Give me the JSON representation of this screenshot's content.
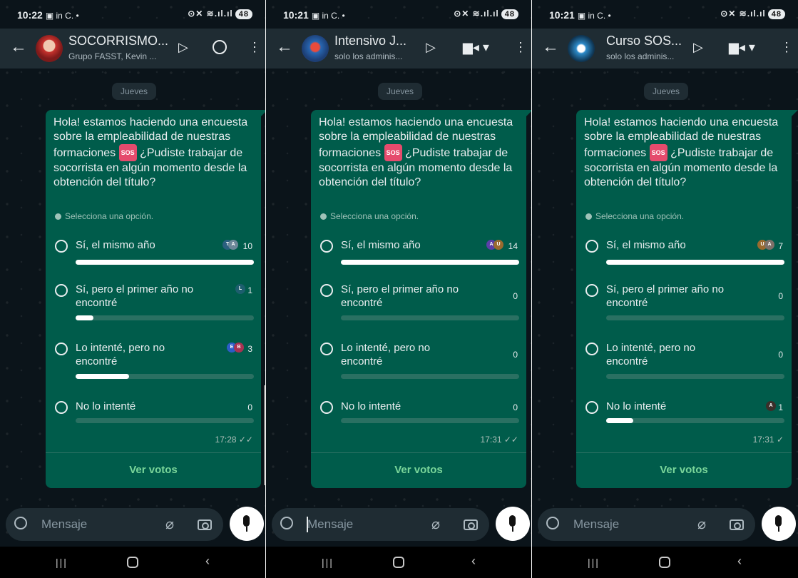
{
  "colors": {
    "bubble": "#005c4b",
    "accent": "#7ad69a",
    "background": "#0b141a",
    "appbar": "#1f2c33"
  },
  "phones": [
    {
      "status_time": "10:22",
      "status_icons": "▣ in C. •",
      "status_right": "⊙✕ ≋.ıl.ıl",
      "battery": "48",
      "chat_title": "SOCORRISMO...",
      "chat_subtitle": "Grupo FASST, Kevin ...",
      "date_chip": "Jueves",
      "question": "Hola! estamos haciendo una encuesta sobre la empleabilidad de nuestras formaciones",
      "sos_emoji": "SOS",
      "question_tail": "¿Pudiste trabajar de socorrista en algún momento desde la obtención del título?",
      "hint": "Selecciona una opción.",
      "options": [
        {
          "label": "Sí, el mismo año",
          "count": "10",
          "share": 1.0,
          "voters": [
            "T",
            "A"
          ]
        },
        {
          "label": "Sí, pero el primer año no encontré",
          "count": "1",
          "share": 0.1,
          "voters": [
            "L"
          ]
        },
        {
          "label": "Lo intenté, pero no encontré",
          "count": "3",
          "share": 0.3,
          "voters": [
            "E",
            "B"
          ]
        },
        {
          "label": "No lo intenté",
          "count": "0",
          "share": 0.0,
          "voters": []
        }
      ],
      "time": "17:28 ✓✓",
      "view_votes": "Ver votos",
      "input_placeholder": "Mensaje"
    },
    {
      "status_time": "10:21",
      "status_icons": "▣ in C. •",
      "status_right": "⊙✕ ≋.ıl.ıl",
      "battery": "48",
      "chat_title": "Intensivo J...",
      "chat_subtitle": "solo los adminis...",
      "date_chip": "Jueves",
      "question": "Hola! estamos haciendo una encuesta sobre la empleabilidad de nuestras formaciones",
      "sos_emoji": "SOS",
      "question_tail": "¿Pudiste trabajar de socorrista en algún momento desde la obtención del título?",
      "hint": "Selecciona una opción.",
      "options": [
        {
          "label": "Sí, el mismo año",
          "count": "14",
          "share": 1.0,
          "voters": [
            "A",
            "U"
          ]
        },
        {
          "label": "Sí, pero el primer año no encontré",
          "count": "0",
          "share": 0.0,
          "voters": []
        },
        {
          "label": "Lo intenté, pero no encontré",
          "count": "0",
          "share": 0.0,
          "voters": []
        },
        {
          "label": "No lo intenté",
          "count": "0",
          "share": 0.0,
          "voters": []
        }
      ],
      "time": "17:31 ✓✓",
      "view_votes": "Ver votos",
      "input_placeholder": "Mensaje"
    },
    {
      "status_time": "10:21",
      "status_icons": "▣ in C. •",
      "status_right": "⊙✕ ≋.ıl.ıl",
      "battery": "48",
      "chat_title": "Curso SOS...",
      "chat_subtitle": "solo los adminis...",
      "date_chip": "Jueves",
      "question": "Hola! estamos haciendo una encuesta sobre la empleabilidad de nuestras formaciones",
      "sos_emoji": "SOS",
      "question_tail": "¿Pudiste trabajar de socorrista en algún momento desde la obtención del título?",
      "hint": "Selecciona una opción.",
      "options": [
        {
          "label": "Sí, el mismo año",
          "count": "7",
          "share": 1.0,
          "voters": [
            "U",
            "A"
          ]
        },
        {
          "label": "Sí, pero el primer año no encontré",
          "count": "0",
          "share": 0.0,
          "voters": []
        },
        {
          "label": "Lo intenté, pero no encontré",
          "count": "0",
          "share": 0.0,
          "voters": []
        },
        {
          "label": "No lo intenté",
          "count": "1",
          "share": 0.15,
          "voters": [
            "A"
          ]
        }
      ],
      "time": "17:31 ✓",
      "view_votes": "Ver votos",
      "input_placeholder": "Mensaje"
    }
  ]
}
